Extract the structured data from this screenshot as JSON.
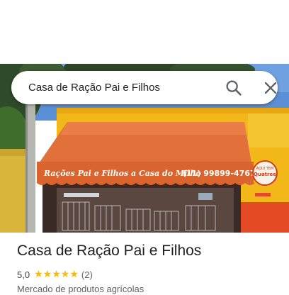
{
  "search": {
    "value": "Casa de Ração Pai e Filhos",
    "search_icon": "search-icon",
    "close_icon": "close-icon"
  },
  "photo": {
    "awning_text": "Rações Pai e Filhos a Casa do Milho",
    "awning_phone": "(11) 99899-4767",
    "sign_text_top": "AQUI TEM",
    "sign_text_main": "Quatree",
    "colors": {
      "awning": "#e2703a",
      "wall": "#f2b81a",
      "sky": "#5b8fd6"
    }
  },
  "place": {
    "name": "Casa de Ração Pai e Filhos",
    "rating": "5,0",
    "stars": 5,
    "star_glyph": "★",
    "review_count": "(2)",
    "category": "Mercado de produtos agrícolas"
  },
  "colors": {
    "star": "#fbbc04",
    "secondary_text": "#5f6368",
    "primary_text": "#202124"
  }
}
